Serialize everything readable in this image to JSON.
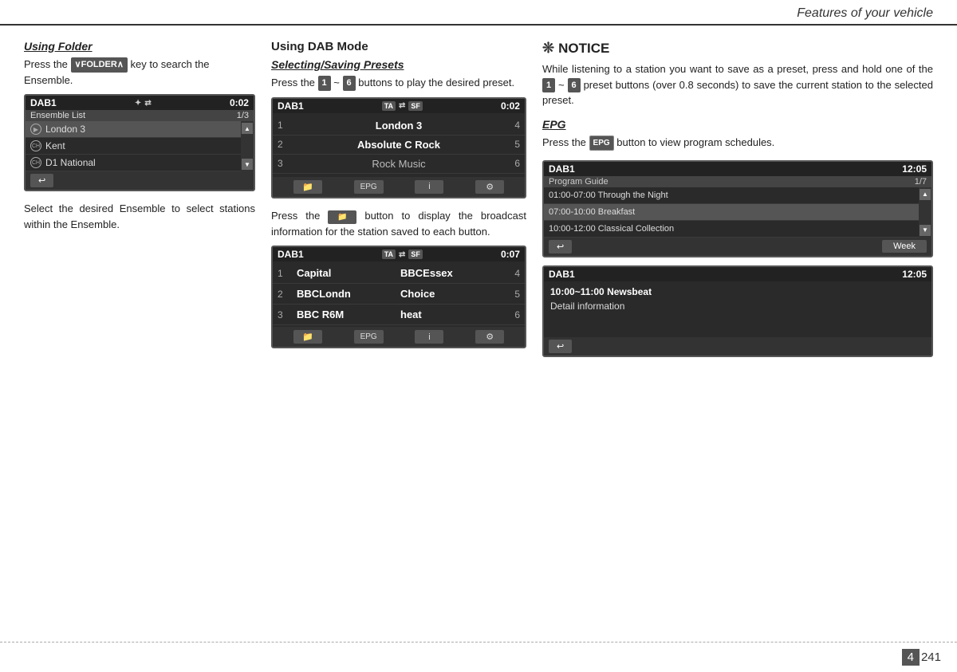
{
  "header": {
    "title": "Features of your vehicle"
  },
  "footer": {
    "page_num": "4",
    "page_total": "241"
  },
  "left_col": {
    "section_title": "Using Folder",
    "body1": "Press the",
    "folder_btn": "∨FOLDER∧",
    "body2": "key to search the Ensemble.",
    "screen1": {
      "label": "DAB1",
      "icon_bt": "✦",
      "icon_usb": "⇄",
      "time": "0:02",
      "subheader_left": "Ensemble List",
      "subheader_right": "1/3",
      "items": [
        {
          "icon": "▶",
          "name": "London 3",
          "selected": true
        },
        {
          "icon": "CH",
          "name": "Kent",
          "selected": false
        },
        {
          "icon": "CH",
          "name": "D1 National",
          "selected": false
        }
      ],
      "back_label": "↩"
    },
    "caption": "Select the desired Ensemble to select stations within the Ensemble."
  },
  "middle_col": {
    "section_title": "Using DAB Mode",
    "subsection_title": "Selecting/Saving Presets",
    "body1": "Press the",
    "btn1": "1",
    "body2": "~",
    "btn2": "6",
    "body3": "buttons to play the desired preset.",
    "screen2": {
      "label": "DAB1",
      "icon_ta": "TA",
      "icon_arrow": "⇄",
      "icon_sf": "SF",
      "time": "0:02",
      "presets": [
        {
          "num": "1",
          "name": "London 3",
          "rnum": "4"
        },
        {
          "num": "2",
          "name": "Absolute C Rock",
          "rnum": "5"
        },
        {
          "num": "3",
          "name": "Rock Music",
          "rnum": "6"
        }
      ],
      "icons": [
        "📁",
        "EPG",
        "i",
        "⚙"
      ]
    },
    "body4_1": "Press the",
    "body4_2": "button to display the broadcast information for the station saved to each button.",
    "screen3": {
      "label": "DAB1",
      "icon_ta": "TA",
      "icon_arrow": "⇄",
      "icon_sf": "SF",
      "time": "0:07",
      "rows": [
        {
          "lnum": "1",
          "lname": "Capital",
          "rname": "BBCEssex",
          "rnum": "4"
        },
        {
          "lnum": "2",
          "lname": "BBCLondn",
          "rname": "Choice",
          "rnum": "5"
        },
        {
          "lnum": "3",
          "lname": "BBC R6M",
          "rname": "heat",
          "rnum": "6"
        }
      ],
      "icons": [
        "📁",
        "EPG",
        "i",
        "⚙"
      ]
    }
  },
  "right_col": {
    "notice_star": "❊",
    "notice_title": "NOTICE",
    "notice_body": "While listening to a station you want to save as a preset, press and hold one of the",
    "notice_btn1": "1",
    "notice_mid": "~",
    "notice_btn2": "6",
    "notice_body2": "preset buttons (over 0.8 seconds) to save the current station to the selected preset.",
    "epg_title": "EPG",
    "epg_body1": "Press the",
    "epg_btn_label": "EPG",
    "epg_body2": "button to view program schedules.",
    "screen_epg1": {
      "label": "DAB1",
      "time": "12:05",
      "subheader_left": "Program Guide",
      "subheader_right": "1/7",
      "items": [
        {
          "text": "01:00-07:00 Through the Night",
          "selected": false
        },
        {
          "text": "07:00-10:00 Breakfast",
          "selected": true
        },
        {
          "text": "10:00-12:00 Classical Collection",
          "selected": false
        }
      ],
      "back_label": "↩",
      "week_label": "Week"
    },
    "screen_epg2": {
      "label": "DAB1",
      "time": "12:05",
      "detail_time": "10:00~11:00 Newsbeat",
      "detail_info": "Detail information",
      "back_label": "↩"
    }
  }
}
